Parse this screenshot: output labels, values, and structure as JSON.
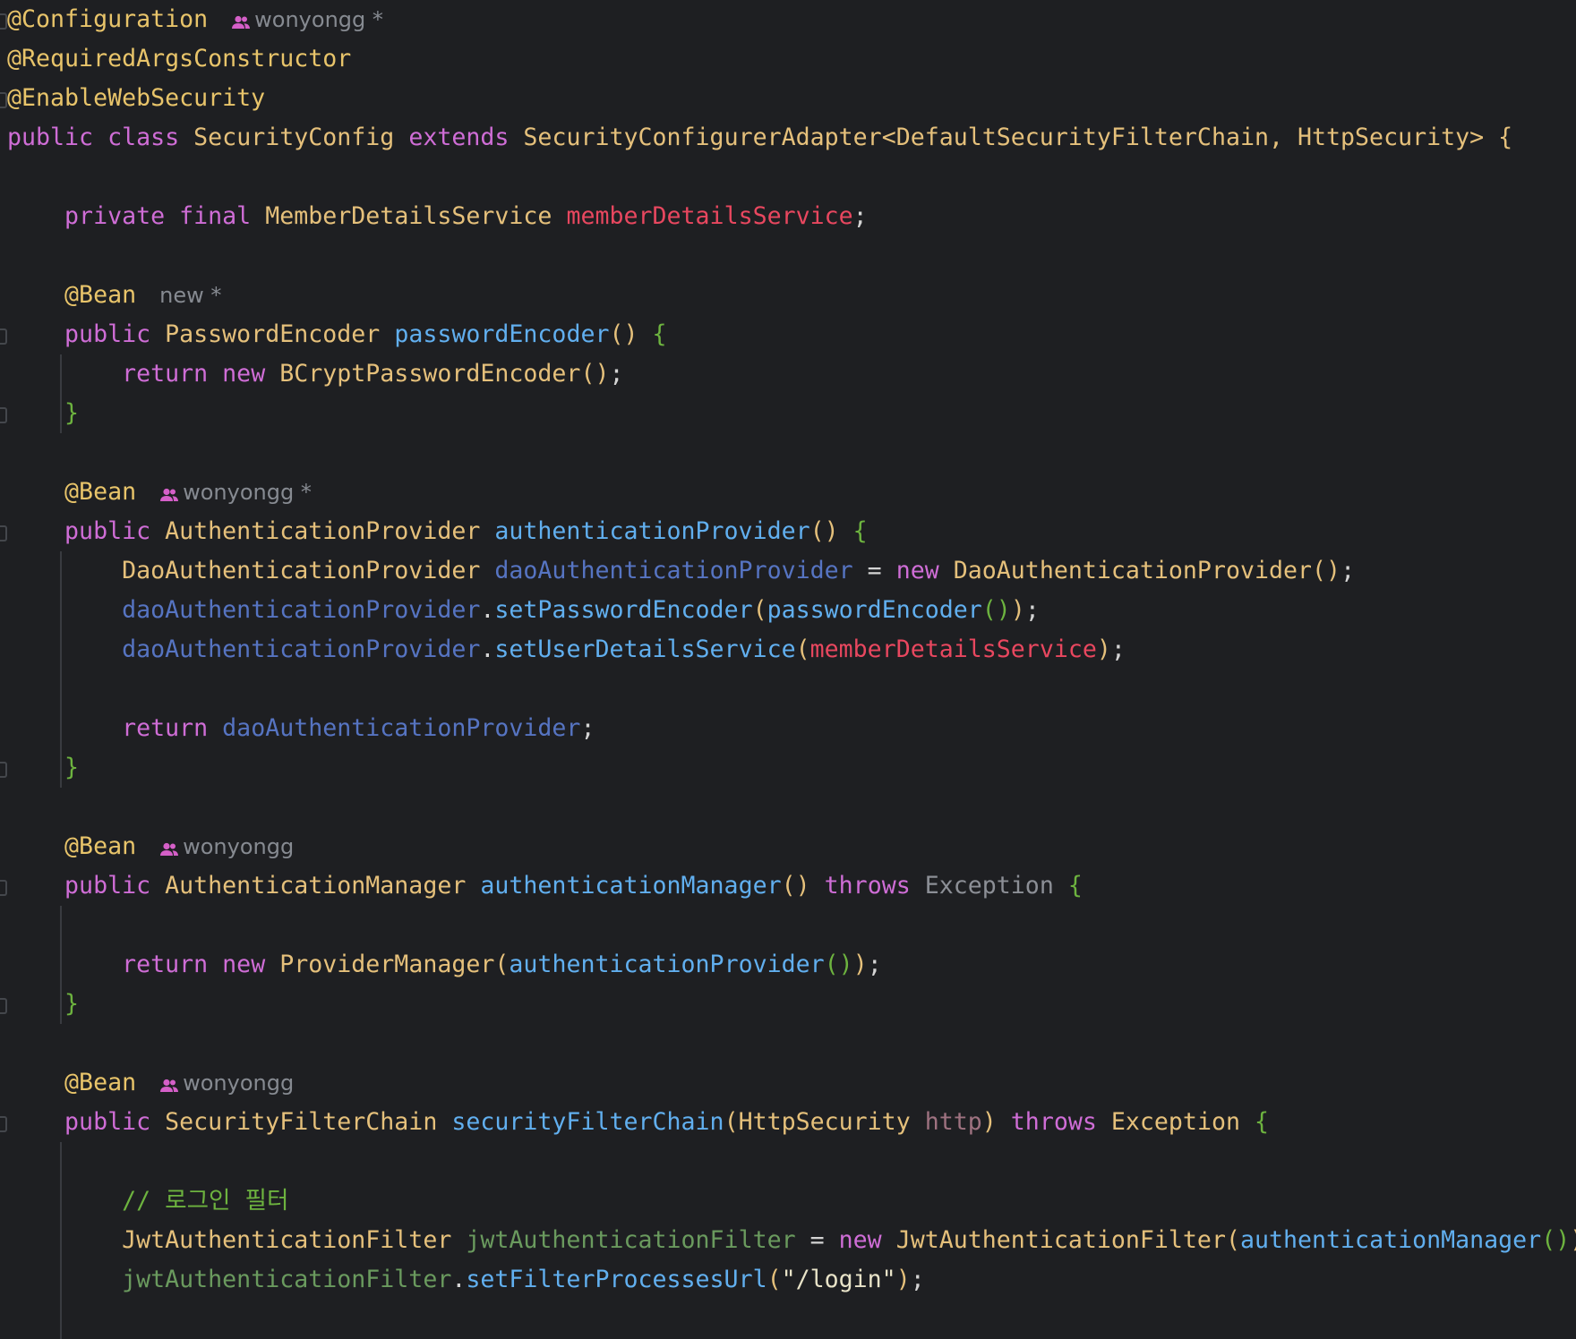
{
  "editor": {
    "language": "java",
    "colors": {
      "background": "#1e1f22",
      "annotation": "#e8c46a",
      "keyword": "#cf6dd6",
      "type": "#e5c07b",
      "method": "#61afef",
      "field": "#e8475f",
      "local_variable": "#5674c2",
      "comment": "#6db33f"
    },
    "lines": [
      {
        "id": "l1",
        "tokens": [
          {
            "t": "@Configuration",
            "c": "ann"
          }
        ],
        "hint": {
          "icon": "users-icon",
          "text": "wonyongg *"
        }
      },
      {
        "id": "l2",
        "tokens": [
          {
            "t": "@RequiredArgsConstructor",
            "c": "ann"
          }
        ]
      },
      {
        "id": "l3",
        "tokens": [
          {
            "t": "@EnableWebSecurity",
            "c": "ann"
          }
        ]
      },
      {
        "id": "l4",
        "tokens": [
          {
            "t": "public ",
            "c": "kw"
          },
          {
            "t": "class ",
            "c": "kw"
          },
          {
            "t": "SecurityConfig ",
            "c": "type"
          },
          {
            "t": "extends ",
            "c": "kw"
          },
          {
            "t": "SecurityConfigurerAdapter<DefaultSecurityFilterChain, HttpSecurity> ",
            "c": "type"
          },
          {
            "t": "{",
            "c": "br1"
          }
        ]
      },
      {
        "id": "l5",
        "tokens": []
      },
      {
        "id": "l6",
        "tokens": [
          {
            "t": "    "
          },
          {
            "t": "private ",
            "c": "kw"
          },
          {
            "t": "final ",
            "c": "kw"
          },
          {
            "t": "MemberDetailsService ",
            "c": "type"
          },
          {
            "t": "memberDetailsService",
            "c": "fld"
          },
          {
            "t": ";",
            "c": "plain"
          }
        ]
      },
      {
        "id": "l7",
        "tokens": []
      },
      {
        "id": "l8",
        "tokens": [
          {
            "t": "    "
          },
          {
            "t": "@Bean",
            "c": "ann"
          }
        ],
        "hint": {
          "icon": "",
          "text": "new *"
        }
      },
      {
        "id": "l9",
        "tokens": [
          {
            "t": "    "
          },
          {
            "t": "public ",
            "c": "kw"
          },
          {
            "t": "PasswordEncoder ",
            "c": "type"
          },
          {
            "t": "passwordEncoder",
            "c": "fn"
          },
          {
            "t": "() ",
            "c": "br1"
          },
          {
            "t": "{",
            "c": "br2"
          }
        ]
      },
      {
        "id": "l10",
        "tokens": [
          {
            "t": "        "
          },
          {
            "t": "return ",
            "c": "kw"
          },
          {
            "t": "new ",
            "c": "kw"
          },
          {
            "t": "BCryptPasswordEncoder",
            "c": "type"
          },
          {
            "t": "()",
            "c": "br1"
          },
          {
            "t": ";",
            "c": "plain"
          }
        ]
      },
      {
        "id": "l11",
        "tokens": [
          {
            "t": "    "
          },
          {
            "t": "}",
            "c": "br2"
          }
        ]
      },
      {
        "id": "l12",
        "tokens": []
      },
      {
        "id": "l13",
        "tokens": [
          {
            "t": "    "
          },
          {
            "t": "@Bean",
            "c": "ann"
          }
        ],
        "hint": {
          "icon": "users-icon",
          "text": "wonyongg *"
        }
      },
      {
        "id": "l14",
        "tokens": [
          {
            "t": "    "
          },
          {
            "t": "public ",
            "c": "kw"
          },
          {
            "t": "AuthenticationProvider ",
            "c": "type"
          },
          {
            "t": "authenticationProvider",
            "c": "fn"
          },
          {
            "t": "() ",
            "c": "br1"
          },
          {
            "t": "{",
            "c": "br2"
          }
        ]
      },
      {
        "id": "l15",
        "tokens": [
          {
            "t": "        "
          },
          {
            "t": "DaoAuthenticationProvider ",
            "c": "type"
          },
          {
            "t": "daoAuthenticationProvider",
            "c": "var"
          },
          {
            "t": " = ",
            "c": "plain"
          },
          {
            "t": "new ",
            "c": "kw"
          },
          {
            "t": "DaoAuthenticationProvider",
            "c": "type"
          },
          {
            "t": "()",
            "c": "br1"
          },
          {
            "t": ";",
            "c": "plain"
          }
        ]
      },
      {
        "id": "l16",
        "tokens": [
          {
            "t": "        "
          },
          {
            "t": "daoAuthenticationProvider",
            "c": "var"
          },
          {
            "t": ".",
            "c": "plain"
          },
          {
            "t": "setPasswordEncoder",
            "c": "fn"
          },
          {
            "t": "(",
            "c": "br1"
          },
          {
            "t": "passwordEncoder",
            "c": "fn"
          },
          {
            "t": "()",
            "c": "br2"
          },
          {
            "t": ")",
            "c": "br1"
          },
          {
            "t": ";",
            "c": "plain"
          }
        ]
      },
      {
        "id": "l17",
        "tokens": [
          {
            "t": "        "
          },
          {
            "t": "daoAuthenticationProvider",
            "c": "var"
          },
          {
            "t": ".",
            "c": "plain"
          },
          {
            "t": "setUserDetailsService",
            "c": "fn"
          },
          {
            "t": "(",
            "c": "br1"
          },
          {
            "t": "memberDetailsService",
            "c": "fld"
          },
          {
            "t": ")",
            "c": "br1"
          },
          {
            "t": ";",
            "c": "plain"
          }
        ]
      },
      {
        "id": "l18",
        "tokens": []
      },
      {
        "id": "l19",
        "tokens": [
          {
            "t": "        "
          },
          {
            "t": "return ",
            "c": "kw"
          },
          {
            "t": "daoAuthenticationProvider",
            "c": "var"
          },
          {
            "t": ";",
            "c": "plain"
          }
        ]
      },
      {
        "id": "l20",
        "tokens": [
          {
            "t": "    "
          },
          {
            "t": "}",
            "c": "br2"
          }
        ]
      },
      {
        "id": "l21",
        "tokens": []
      },
      {
        "id": "l22",
        "tokens": [
          {
            "t": "    "
          },
          {
            "t": "@Bean",
            "c": "ann"
          }
        ],
        "hint": {
          "icon": "users-icon",
          "text": "wonyongg"
        }
      },
      {
        "id": "l23",
        "tokens": [
          {
            "t": "    "
          },
          {
            "t": "public ",
            "c": "kw"
          },
          {
            "t": "AuthenticationManager ",
            "c": "type"
          },
          {
            "t": "authenticationManager",
            "c": "fn"
          },
          {
            "t": "() ",
            "c": "br1"
          },
          {
            "t": "throws ",
            "c": "kw"
          },
          {
            "t": "Exception ",
            "c": "exc"
          },
          {
            "t": "{",
            "c": "br2"
          }
        ]
      },
      {
        "id": "l24",
        "tokens": []
      },
      {
        "id": "l25",
        "tokens": [
          {
            "t": "        "
          },
          {
            "t": "return ",
            "c": "kw"
          },
          {
            "t": "new ",
            "c": "kw"
          },
          {
            "t": "ProviderManager",
            "c": "type"
          },
          {
            "t": "(",
            "c": "br1"
          },
          {
            "t": "authenticationProvider",
            "c": "fn"
          },
          {
            "t": "()",
            "c": "br2"
          },
          {
            "t": ")",
            "c": "br1"
          },
          {
            "t": ";",
            "c": "plain"
          }
        ]
      },
      {
        "id": "l26",
        "tokens": [
          {
            "t": "    "
          },
          {
            "t": "}",
            "c": "br2"
          }
        ]
      },
      {
        "id": "l27",
        "tokens": []
      },
      {
        "id": "l28",
        "tokens": [
          {
            "t": "    "
          },
          {
            "t": "@Bean",
            "c": "ann"
          }
        ],
        "hint": {
          "icon": "users-icon",
          "text": "wonyongg"
        }
      },
      {
        "id": "l29",
        "tokens": [
          {
            "t": "    "
          },
          {
            "t": "public ",
            "c": "kw"
          },
          {
            "t": "SecurityFilterChain ",
            "c": "type"
          },
          {
            "t": "securityFilterChain",
            "c": "fn"
          },
          {
            "t": "(",
            "c": "br1"
          },
          {
            "t": "HttpSecurity ",
            "c": "type"
          },
          {
            "t": "http",
            "c": "par"
          },
          {
            "t": ") ",
            "c": "br1"
          },
          {
            "t": "throws ",
            "c": "kw"
          },
          {
            "t": "Exception ",
            "c": "type"
          },
          {
            "t": "{",
            "c": "br2"
          }
        ]
      },
      {
        "id": "l30",
        "tokens": []
      },
      {
        "id": "l31",
        "tokens": [
          {
            "t": "        "
          },
          {
            "t": "// 로그인 필터",
            "c": "cmt"
          }
        ]
      },
      {
        "id": "l32",
        "tokens": [
          {
            "t": "        "
          },
          {
            "t": "JwtAuthenticationFilter ",
            "c": "type"
          },
          {
            "t": "jwtAuthenticationFilter",
            "c": "var2"
          },
          {
            "t": " = ",
            "c": "plain"
          },
          {
            "t": "new ",
            "c": "kw"
          },
          {
            "t": "JwtAuthenticationFilter",
            "c": "type"
          },
          {
            "t": "(",
            "c": "br1"
          },
          {
            "t": "authenticationManager",
            "c": "fn"
          },
          {
            "t": "()",
            "c": "br2"
          },
          {
            "t": ")",
            "c": "br1"
          },
          {
            "t": ";",
            "c": "plain"
          }
        ]
      },
      {
        "id": "l33",
        "tokens": [
          {
            "t": "        "
          },
          {
            "t": "jwtAuthenticationFilter",
            "c": "var2"
          },
          {
            "t": ".",
            "c": "plain"
          },
          {
            "t": "setFilterProcessesUrl",
            "c": "fn"
          },
          {
            "t": "(",
            "c": "br1"
          },
          {
            "t": "\"/login\"",
            "c": "str"
          },
          {
            "t": ")",
            "c": "br1"
          },
          {
            "t": ";",
            "c": "plain"
          }
        ]
      }
    ]
  }
}
